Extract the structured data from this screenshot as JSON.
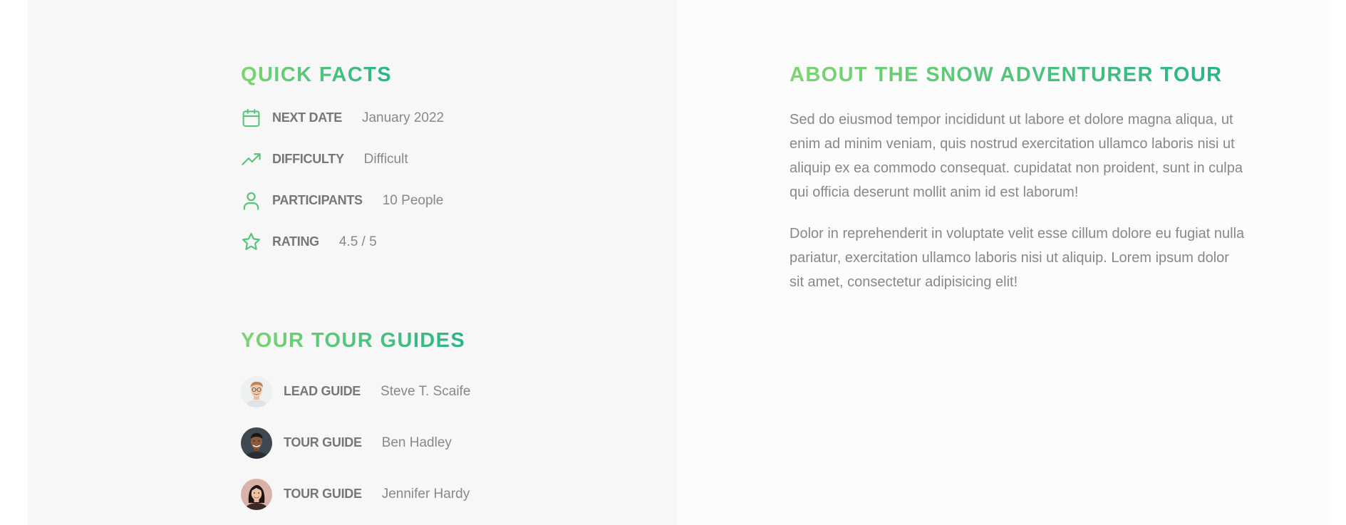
{
  "colors": {
    "gradient_start": "#7dd56f",
    "gradient_end": "#28b487",
    "icon_color": "#55c57a",
    "label_color": "#777777",
    "value_color": "#888888",
    "facts_bg": "#f7f7f7",
    "about_bg": "#fcfcfc"
  },
  "quick_facts": {
    "heading": "Quick Facts",
    "items": [
      {
        "icon": "calendar-icon",
        "label": "Next Date",
        "value": "January 2022"
      },
      {
        "icon": "trending-up-icon",
        "label": "Difficulty",
        "value": "Difficult"
      },
      {
        "icon": "user-icon",
        "label": "Participants",
        "value": "10 People"
      },
      {
        "icon": "star-icon",
        "label": "Rating",
        "value": "4.5 / 5"
      }
    ]
  },
  "tour_guides": {
    "heading": "Your Tour Guides",
    "items": [
      {
        "role": "Lead Guide",
        "name": "Steve T. Scaife"
      },
      {
        "role": "Tour Guide",
        "name": "Ben Hadley"
      },
      {
        "role": "Tour Guide",
        "name": "Jennifer Hardy"
      }
    ]
  },
  "about": {
    "heading": "About the Snow Adventurer Tour",
    "paragraphs": [
      "Sed do eiusmod tempor incididunt ut labore et dolore magna aliqua, ut enim ad minim veniam, quis nostrud exercitation ullamco laboris nisi ut aliquip ex ea commodo consequat. cupidatat non proident, sunt in culpa qui officia deserunt mollit anim id est laborum!",
      "Dolor in reprehenderit in voluptate velit esse cillum dolore eu fugiat nulla pariatur, exercitation ullamco laboris nisi ut aliquip. Lorem ipsum dolor sit amet, consectetur adipisicing elit!"
    ]
  }
}
